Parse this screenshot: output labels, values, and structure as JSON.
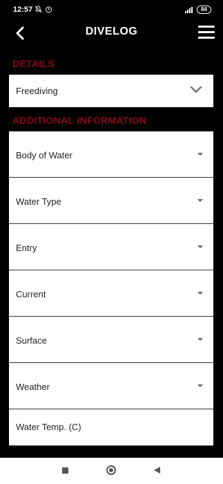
{
  "status_bar": {
    "time": "12:57",
    "icons_left": [
      "no-notifications-icon",
      "alarm-icon"
    ],
    "network": "4G",
    "battery": "84"
  },
  "header": {
    "title": "DIVELOG",
    "back_icon": "back-arrow-icon",
    "menu_icon": "hamburger-menu-icon"
  },
  "details": {
    "heading": "DETAILS",
    "dive_type": "Freediving"
  },
  "additional_information": {
    "heading": "ADDITIONAL INFORMATION",
    "fields": [
      {
        "label": "Body of Water"
      },
      {
        "label": "Water Type"
      },
      {
        "label": "Entry"
      },
      {
        "label": "Current"
      },
      {
        "label": "Surface"
      },
      {
        "label": "Weather"
      }
    ],
    "water_temp_placeholder": "Water Temp. (C)"
  },
  "colors": {
    "heading_red": "#8a0b12",
    "background": "#000000",
    "field_bg": "#ffffff"
  }
}
